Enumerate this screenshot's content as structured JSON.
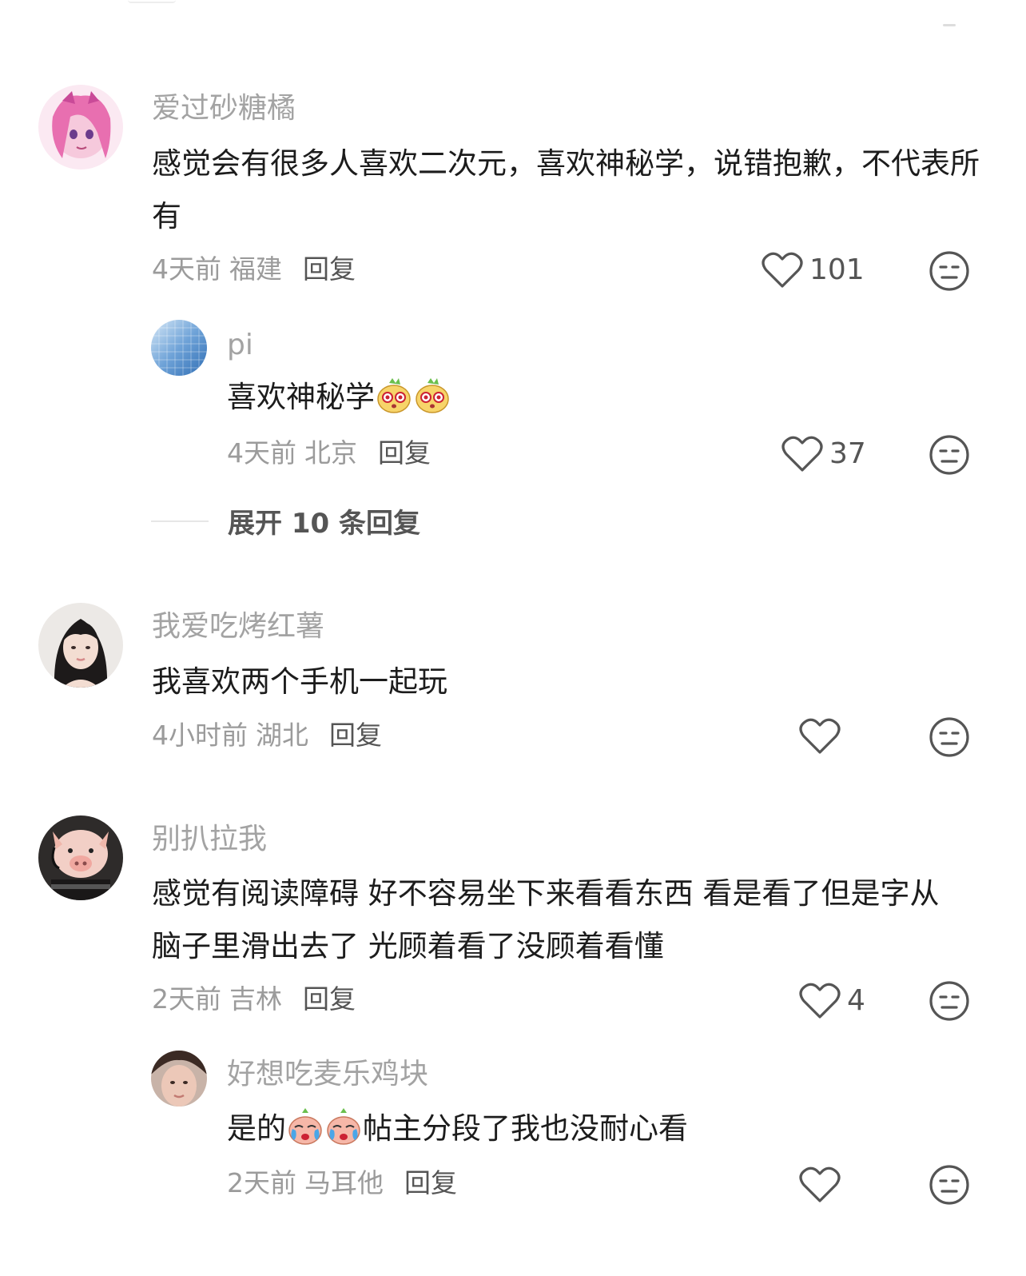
{
  "comments": [
    {
      "user": "爱过砂糖橘",
      "text": "感觉会有很多人喜欢二次元，喜欢神秘学，说错抱歉，不代表所有",
      "time": "4天前",
      "location": "福建",
      "reply_label": "回复",
      "likes": "101",
      "avatar": "anime-girl-pink-hair"
    },
    {
      "user": "pi",
      "text": "喜欢神秘学",
      "emojis": [
        "shocked-face-emoji",
        "shocked-face-emoji"
      ],
      "time": "4天前",
      "location": "北京",
      "reply_label": "回复",
      "likes": "37",
      "avatar": "blue-gradient",
      "is_reply": true
    },
    {
      "user": "我爱吃烤红薯",
      "text": "我喜欢两个手机一起玩",
      "time": "4小时前",
      "location": "湖北",
      "reply_label": "回复",
      "likes": "",
      "avatar": "girl-photo"
    },
    {
      "user": "别扒拉我",
      "text": "感觉有阅读障碍 好不容易坐下来看看东西 看是看了但是字从脑子里滑出去了 光顾着看了没顾着看懂",
      "time": "2天前",
      "location": "吉林",
      "reply_label": "回复",
      "likes": "4",
      "avatar": "pig-with-headset"
    },
    {
      "user": "好想吃麦乐鸡块",
      "text_before": "是的",
      "text_after": "帖主分段了我也没耐心看",
      "emojis": [
        "crying-face-emoji",
        "crying-face-emoji"
      ],
      "time": "2天前",
      "location": "马耳他",
      "reply_label": "回复",
      "likes": "",
      "avatar": "girl-selfie",
      "is_reply": true
    }
  ],
  "expand_replies": "展开 10 条回复",
  "colors": {
    "username": "#a3a3a3",
    "text": "#1c1c1c",
    "meta": "#9b9b9b",
    "icon": "#555555"
  }
}
